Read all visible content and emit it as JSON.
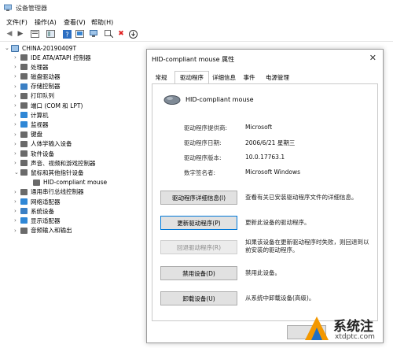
{
  "window": {
    "title": "设备管理器"
  },
  "menu": [
    "文件(F)",
    "操作(A)",
    "查看(V)",
    "帮助(H)"
  ],
  "tree": {
    "root": "CHINA-20190409T",
    "items": [
      {
        "label": "IDE ATA/ATAPI 控制器",
        "icon_color": "#6a6a6a"
      },
      {
        "label": "处理器",
        "icon_color": "#6a6a6a"
      },
      {
        "label": "磁盘驱动器",
        "icon_color": "#6a6a6a"
      },
      {
        "label": "存储控制器",
        "icon_color": "#3a7fc4"
      },
      {
        "label": "打印队列",
        "icon_color": "#6a6a6a"
      },
      {
        "label": "端口 (COM 和 LPT)",
        "icon_color": "#6a6a6a"
      },
      {
        "label": "计算机",
        "icon_color": "#2f87d6"
      },
      {
        "label": "监视器",
        "icon_color": "#2f87d6"
      },
      {
        "label": "键盘",
        "icon_color": "#6a6a6a"
      },
      {
        "label": "人体学输入设备",
        "icon_color": "#6a6a6a"
      },
      {
        "label": "软件设备",
        "icon_color": "#6a6a6a"
      },
      {
        "label": "声音、视频和游戏控制器",
        "icon_color": "#6a6a6a"
      },
      {
        "label": "鼠标和其他指针设备",
        "icon_color": "#6a6a6a",
        "expanded": true
      },
      {
        "label": "HID-compliant mouse",
        "icon_color": "#6a6a6a",
        "child": true
      },
      {
        "label": "通用串行总线控制器",
        "icon_color": "#6a6a6a"
      },
      {
        "label": "网络适配器",
        "icon_color": "#2f87d6"
      },
      {
        "label": "系统设备",
        "icon_color": "#3a7fc4"
      },
      {
        "label": "显示适配器",
        "icon_color": "#2f87d6"
      },
      {
        "label": "音频输入和输出",
        "icon_color": "#6a6a6a"
      }
    ]
  },
  "dialog": {
    "title": "HID-compliant mouse 属性",
    "tabs": [
      "常规",
      "驱动程序",
      "详细信息",
      "事件",
      "电源管理"
    ],
    "active_tab": "驱动程序",
    "device_name": "HID-compliant mouse",
    "props": [
      {
        "label": "驱动程序提供商:",
        "value": "Microsoft"
      },
      {
        "label": "驱动程序日期:",
        "value": "2006/6/21 星期三"
      },
      {
        "label": "驱动程序版本:",
        "value": "10.0.17763.1"
      },
      {
        "label": "数字签名者:",
        "value": "Microsoft Windows"
      }
    ],
    "actions": [
      {
        "button": "驱动程序详细信息(I)",
        "desc": "查看有关已安装驱动程序文件的详细信息。"
      },
      {
        "button": "更新驱动程序(P)",
        "desc": "更新此设备的驱动程序。"
      },
      {
        "button": "回退驱动程序(R)",
        "desc": "如果该设备在更新驱动程序时失败，则回退到以前安装的驱动程序。"
      },
      {
        "button": "禁用设备(D)",
        "desc": "禁用此设备。"
      },
      {
        "button": "卸载设备(U)",
        "desc": "从系统中卸载设备(高级)。"
      }
    ]
  },
  "watermark": {
    "name": "系统注",
    "url": "xtdptc.com"
  },
  "colors": {
    "accent": "#0078d7",
    "watermark_orange": "#f39800",
    "watermark_blue": "#1f6fc4"
  }
}
